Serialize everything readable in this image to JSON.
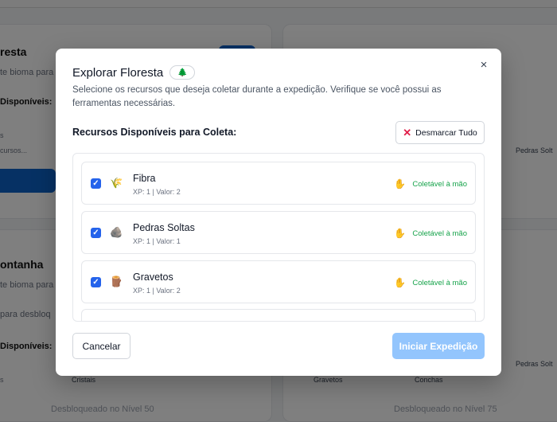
{
  "background": {
    "card1": {
      "title": "resta",
      "subtitle": "te bioma para",
      "label": "Disponíveis:",
      "item": "s",
      "item_sub": "cursos...",
      "right_chip": "Pedras Solt"
    },
    "card2": {
      "title": "ontanha",
      "subtitle": "te bioma para",
      "note": "para desbloq",
      "label": "Disponíveis:",
      "item": "s",
      "chip1": "Cristais",
      "chip2": "Gravetos",
      "chip3": "Conchas",
      "right_chip": "Pedras Solt",
      "lock_left": "Desbloqueado no Nível 50",
      "lock_right": "Desbloqueado no Nível 75"
    }
  },
  "modal": {
    "title": "Explorar Floresta",
    "title_badge_icon": "tree-icon",
    "title_badge_glyph": "🌲",
    "close_glyph": "×",
    "description": "Selecione os recursos que deseja coletar durante a expedição. Verifique se você possui as ferramentas necessárias.",
    "section_title": "Recursos Disponíveis para Coleta:",
    "unselect_label": "Desmarcar Tudo",
    "unselect_glyph": "✕",
    "items": [
      {
        "name": "Fibra",
        "meta": "XP: 1 | Valor: 2",
        "status": "Coletável à mão",
        "icon": "fiber-icon",
        "glyph": "🌾",
        "checked": true
      },
      {
        "name": "Pedras Soltas",
        "meta": "XP: 1 | Valor: 1",
        "status": "Coletável à mão",
        "icon": "rock-icon",
        "glyph": "🪨",
        "checked": true
      },
      {
        "name": "Gravetos",
        "meta": "XP: 1 | Valor: 2",
        "status": "Coletável à mão",
        "icon": "wood-icon",
        "glyph": "🪵",
        "checked": true
      }
    ],
    "status_glyph": "✋",
    "cancel_label": "Cancelar",
    "start_label": "Iniciar Expedição",
    "colors": {
      "primary": "#2563eb",
      "start_disabled": "#93c5fd",
      "status": "#16a34a",
      "danger": "#e11d48"
    }
  }
}
